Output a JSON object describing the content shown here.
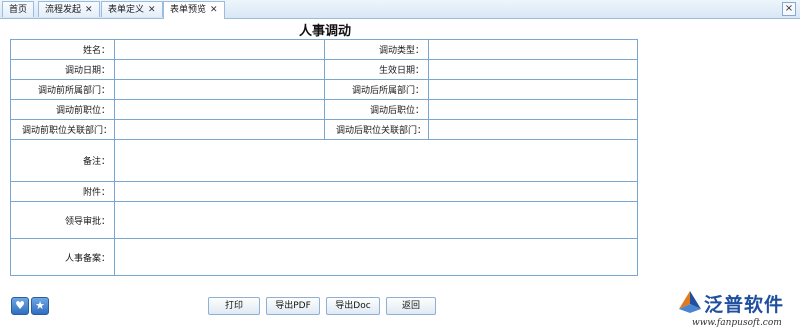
{
  "tabs": [
    {
      "label": "首页",
      "closable": false
    },
    {
      "label": "流程发起",
      "closable": true
    },
    {
      "label": "表单定义",
      "closable": true
    },
    {
      "label": "表单预览",
      "closable": true,
      "active": true
    }
  ],
  "window_close": "×",
  "form": {
    "title": "人事调动",
    "rows": [
      {
        "left_label": "姓名：",
        "right_label": "调动类型："
      },
      {
        "left_label": "调动日期：",
        "right_label": "生效日期："
      },
      {
        "left_label": "调动前所属部门：",
        "right_label": "调动后所属部门："
      },
      {
        "left_label": "调动前职位：",
        "right_label": "调动后职位："
      },
      {
        "left_label": "调动前职位关联部门：",
        "right_label": "调动后职位关联部门："
      }
    ],
    "remark_label": "备注：",
    "attachment_label": "附件：",
    "leader_approval_label": "领导审批：",
    "hr_record_label": "人事备案："
  },
  "toolbar": {
    "print": "打印",
    "export_pdf": "导出PDF",
    "export_doc": "导出Doc",
    "back": "返回"
  },
  "icons": {
    "favorite": "heart-icon",
    "star": "star-icon"
  },
  "brand": {
    "name": "泛普软件",
    "url": "www.fanpusoft.com"
  }
}
